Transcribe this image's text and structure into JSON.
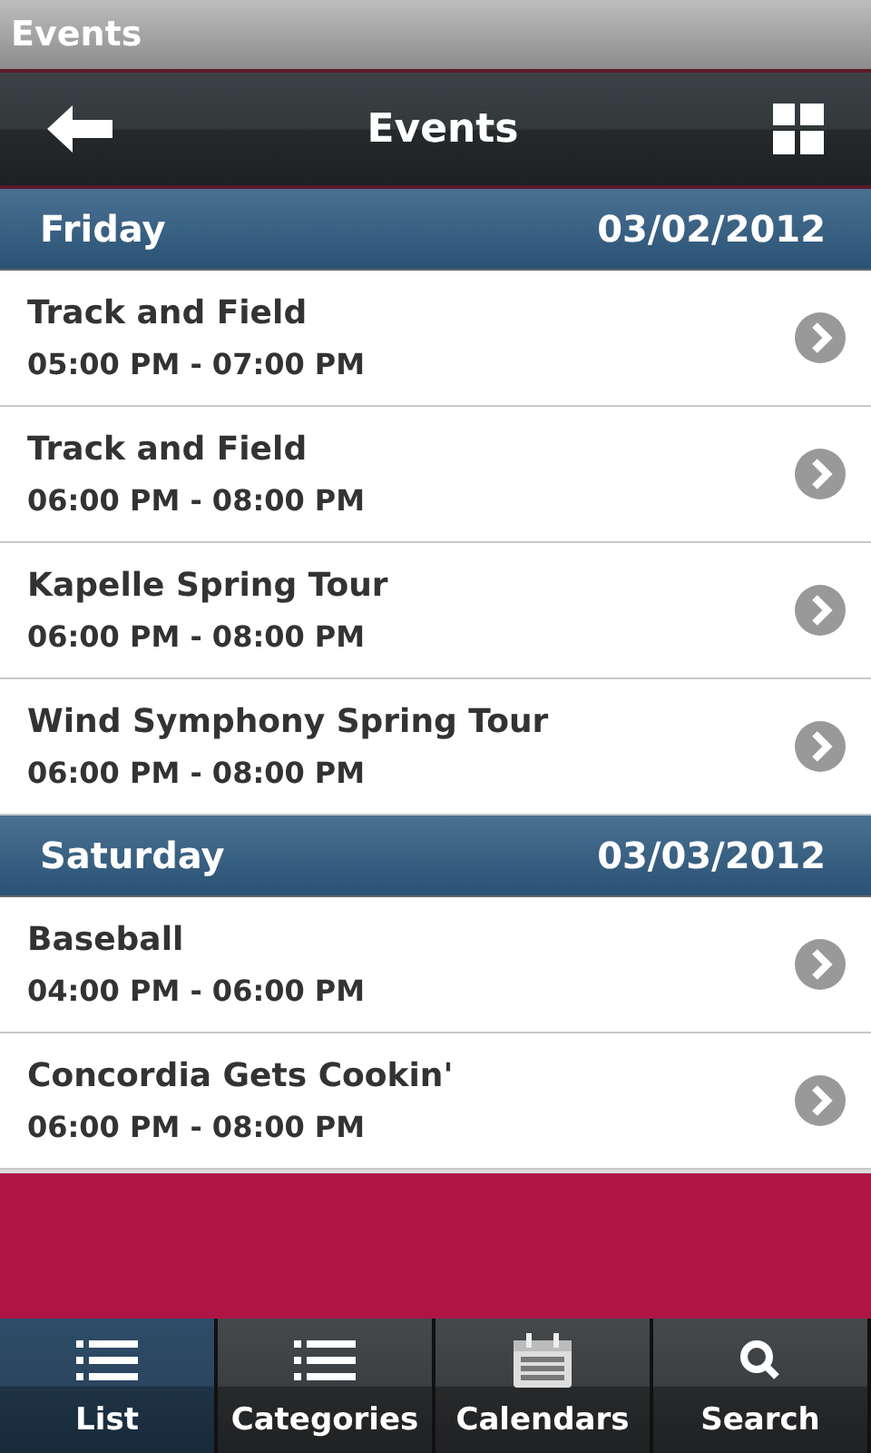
{
  "window": {
    "title": "Events"
  },
  "header": {
    "title": "Events"
  },
  "sections": [
    {
      "day": "Friday",
      "date": "03/02/2012",
      "events": [
        {
          "name": "Track and Field",
          "time": "05:00 PM - 07:00 PM"
        },
        {
          "name": "Track and Field",
          "time": "06:00 PM - 08:00 PM"
        },
        {
          "name": "Kapelle Spring Tour",
          "time": "06:00 PM - 08:00 PM"
        },
        {
          "name": "Wind Symphony Spring Tour",
          "time": "06:00 PM - 08:00 PM"
        }
      ]
    },
    {
      "day": "Saturday",
      "date": "03/03/2012",
      "events": [
        {
          "name": "Baseball",
          "time": "04:00 PM - 06:00 PM"
        },
        {
          "name": "Concordia Gets Cookin'",
          "time": "06:00 PM - 08:00 PM"
        }
      ]
    }
  ],
  "tabs": [
    {
      "label": "List",
      "kind": "list",
      "selected": true
    },
    {
      "label": "Categories",
      "kind": "list",
      "selected": false
    },
    {
      "label": "Calendars",
      "kind": "calendar",
      "selected": false
    },
    {
      "label": "Search",
      "kind": "search",
      "selected": false
    }
  ]
}
